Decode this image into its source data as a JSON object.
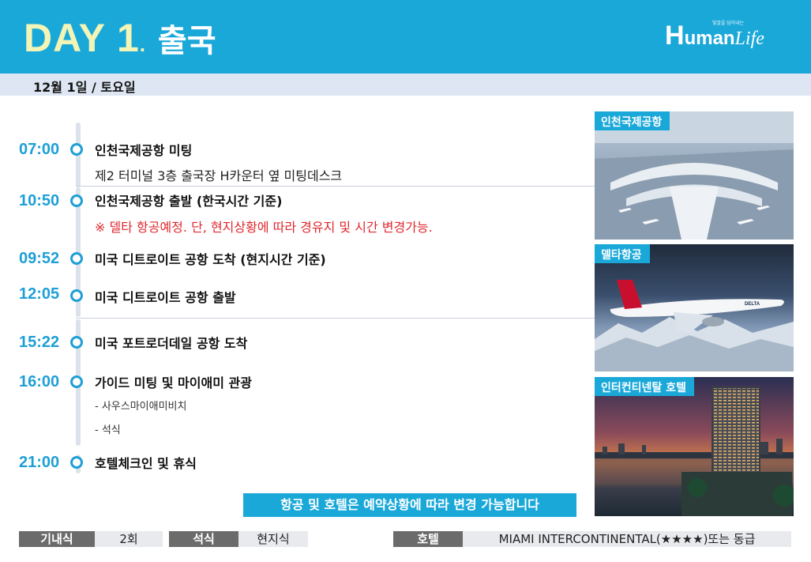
{
  "header": {
    "day_label": "DAY 1",
    "day_dot": ".",
    "day_subtitle": "출국",
    "logo_h": "H",
    "logo_uman": "uman",
    "logo_life": "Life",
    "logo_tagline": "빛깔을 담아내는"
  },
  "date": "12월 1일 / 토요일",
  "schedule": [
    {
      "time": "07:00",
      "title": "인천국제공항 미팅",
      "detail": "제2 터미널 3층 출국장 H카운터 옆 미팅데스크"
    },
    {
      "time": "10:50",
      "title": "인천국제공항 출발 (한국시간 기준)",
      "detail": "※ 델타 항공예정. 단, 현지상황에 따라 경유지 및 시간 변경가능."
    },
    {
      "time": "09:52",
      "title": "미국 디트로이트 공항 도착 (현지시간 기준)"
    },
    {
      "time": "12:05",
      "title": "미국 디트로이트 공항 출발"
    },
    {
      "time": "15:22",
      "title": "미국 포트로더데일 공항 도착"
    },
    {
      "time": "16:00",
      "title": "가이드 미팅 및 마이애미 관광",
      "subs": [
        "- 사우스마이애미비치",
        "- 석식"
      ]
    },
    {
      "time": "21:00",
      "title": "호텔체크인 및 휴식"
    }
  ],
  "photos": [
    {
      "label": "인천국제공항",
      "icon": "airport-terminal-photo"
    },
    {
      "label": "델타항공",
      "icon": "delta-airplane-photo",
      "brand": "DELTA"
    },
    {
      "label": "인터컨티넨탈 호텔",
      "icon": "hotel-skyline-photo"
    }
  ],
  "notice": "항공 및 호텔은 예약상황에 따라 변경 가능합니다",
  "footer": {
    "inflight_label": "기내식",
    "inflight_value": "2회",
    "dinner_label": "석식",
    "dinner_value": "현지식",
    "hotel_label": "호텔",
    "hotel_value": "MIAMI INTERCONTINENTAL(★★★★)또는 동급"
  },
  "colors": {
    "accent": "#1aa8d9",
    "day_title": "#f3f5b7",
    "time_blue": "#1e9fd6",
    "warning_red": "#e0282e",
    "date_bar": "#dde6f2",
    "footer_label": "#6b6b6b"
  }
}
